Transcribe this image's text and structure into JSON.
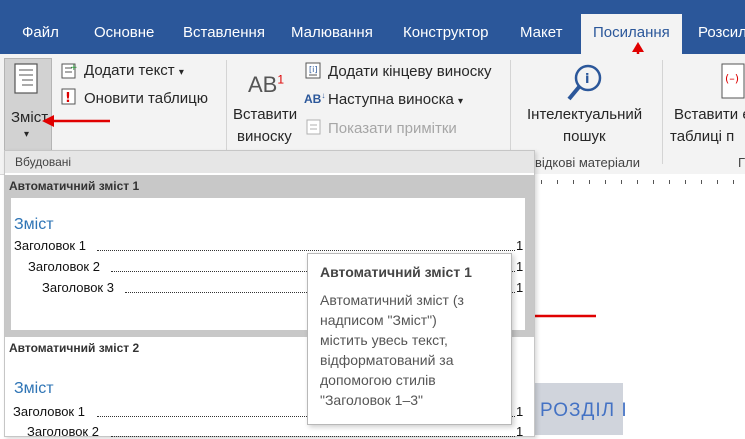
{
  "tabs": [
    "Файл",
    "Основне",
    "Вставлення",
    "Малювання",
    "Конструктор",
    "Макет",
    "Посилання",
    "Розсил"
  ],
  "active_tab": "Посилання",
  "ribbon": {
    "toc_button": "Зміст",
    "add_text": "Додати текст",
    "update_table": "Оновити таблицю",
    "insert_footnote_line1": "Вставити",
    "insert_footnote_line2": "виноску",
    "ab_glyph": "AB",
    "ab_superscript": "1",
    "ab_small": "AB",
    "add_endnote": "Додати кінцеву виноску",
    "next_footnote": "Наступна виноска",
    "show_notes": "Показати примітки",
    "smart_lookup_line1": "Інтелектуальний",
    "smart_lookup_line2": "пошук",
    "research_group": "відкові матеріали",
    "insert_table_line1": "Вставити е",
    "insert_table_line2": "таблиці п",
    "group_end": "Г"
  },
  "gallery": {
    "section_header": "Вбудовані",
    "item1_title": "Автоматичний зміст 1",
    "item2_title": "Автоматичний зміст 2",
    "toc_heading": "Зміст",
    "lines1": [
      {
        "text": "Заголовок 1",
        "num": "1"
      },
      {
        "text": "Заголовок 2",
        "num": "1"
      },
      {
        "text": "Заголовок 3",
        "num": "1"
      }
    ],
    "lines2": [
      {
        "text": "Заголовок 1",
        "num": "1"
      },
      {
        "text": "Заголовок 2",
        "num": "1"
      }
    ]
  },
  "tooltip": {
    "title": "Автоматичний зміст 1",
    "lines": [
      "Автоматичний зміст (з",
      "надписом \"Зміст\")",
      "містить увесь текст,",
      "відформатований за",
      "допомогою стилів",
      "\"Заголовок 1–3\""
    ]
  },
  "document": {
    "heading": "РОЗДІЛ І"
  },
  "colors": {
    "tabbar": "#2b579a",
    "accent_heading": "#2e74b5",
    "annotation_arrow": "#e00000"
  }
}
